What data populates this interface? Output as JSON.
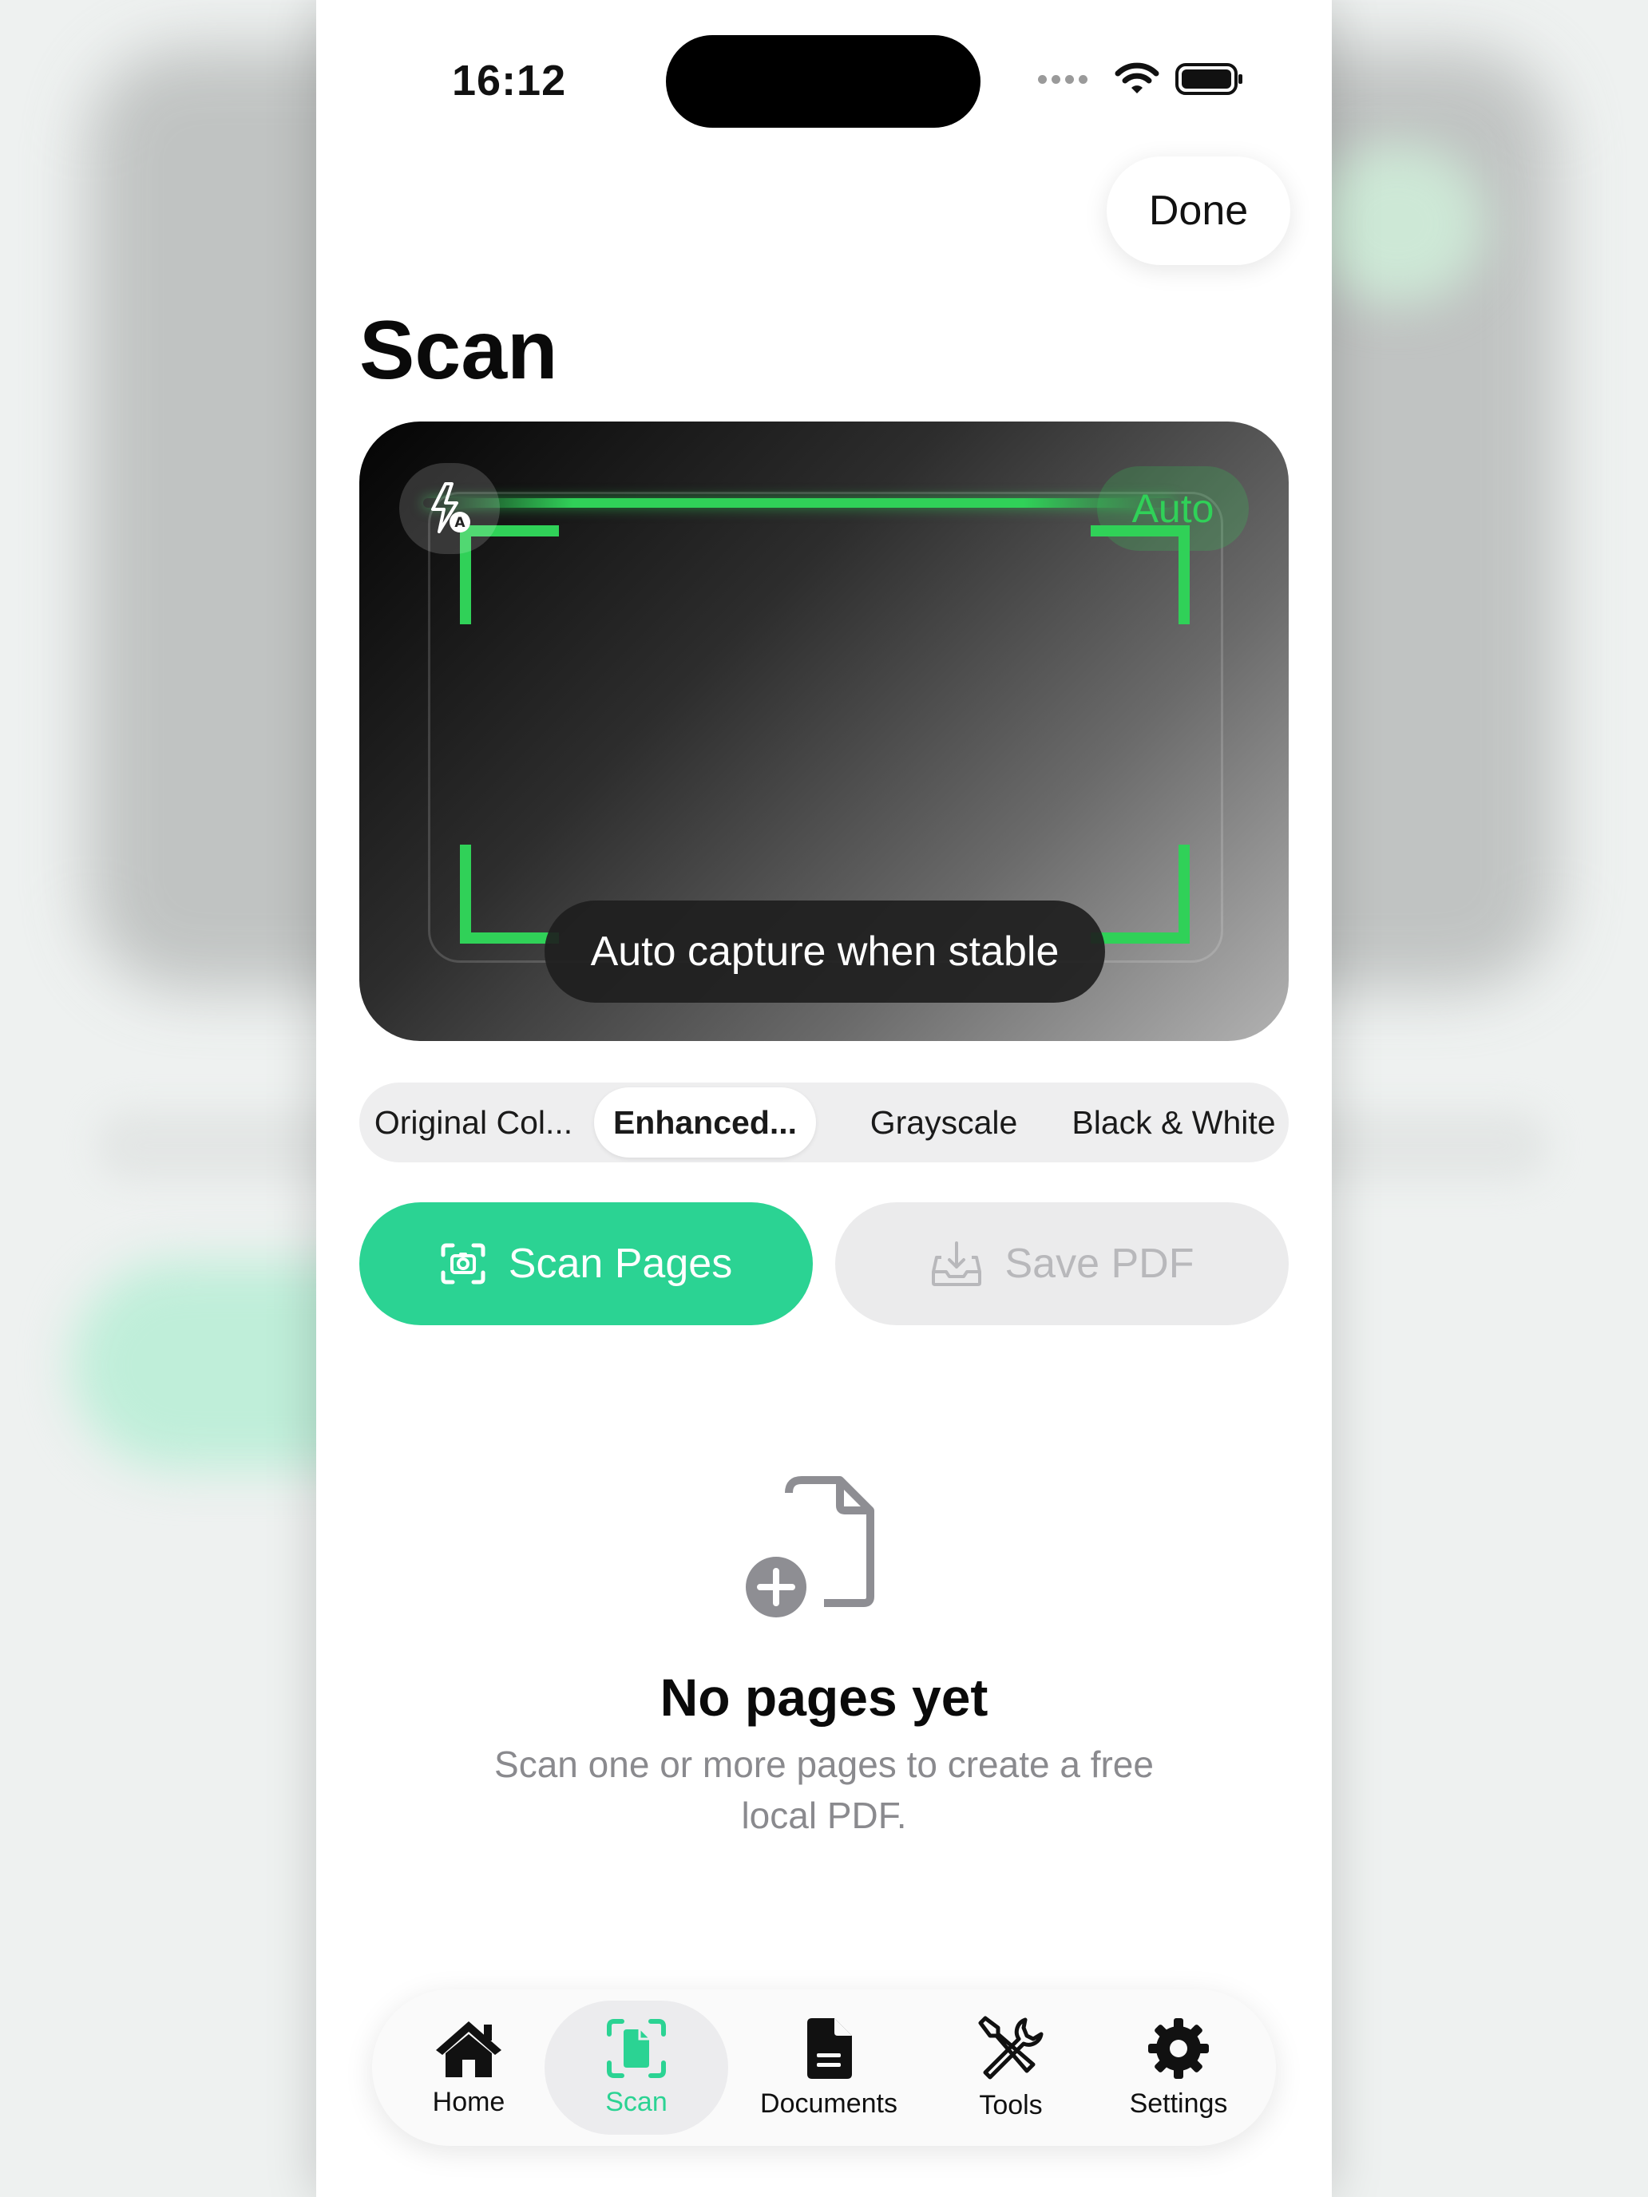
{
  "status_bar": {
    "time": "16:12"
  },
  "header": {
    "done_label": "Done",
    "title": "Scan"
  },
  "preview": {
    "auto_label": "Auto",
    "capture_hint": "Auto capture when stable",
    "accent_color": "#30d158"
  },
  "filters": {
    "options": [
      "Original Col...",
      "Enhanced...",
      "Grayscale",
      "Black & White"
    ],
    "selected": "Enhanced..."
  },
  "actions": {
    "scan_label": "Scan Pages",
    "save_label": "Save PDF",
    "scan_color": "#2bd393"
  },
  "empty_state": {
    "title": "No pages yet",
    "subtitle": "Scan one or more pages to create a free local PDF."
  },
  "tabbar": {
    "items": [
      {
        "label": "Home",
        "icon": "house-icon"
      },
      {
        "label": "Scan",
        "icon": "doc-scan-icon"
      },
      {
        "label": "Documents",
        "icon": "document-icon"
      },
      {
        "label": "Tools",
        "icon": "tools-icon"
      },
      {
        "label": "Settings",
        "icon": "gear-icon"
      }
    ],
    "active": "Scan"
  }
}
